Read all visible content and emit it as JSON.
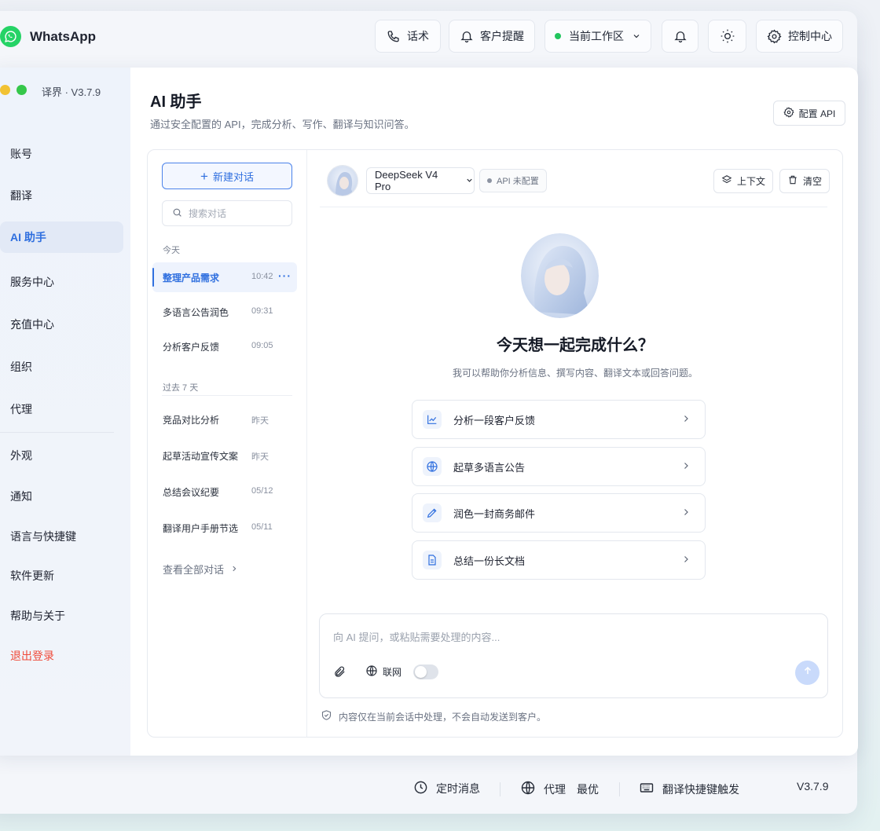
{
  "app": {
    "name": "WhatsApp",
    "version_label": "译界 · V3.7.9"
  },
  "topbar": {
    "scripts_label": "话术",
    "reminders_label": "客户提醒",
    "workspace_label": "当前工作区",
    "control_center_label": "控制中心"
  },
  "sidebar": {
    "items": [
      {
        "label": "账号"
      },
      {
        "label": "翻译"
      },
      {
        "label": "AI 助手"
      },
      {
        "label": "服务中心"
      },
      {
        "label": "充值中心"
      },
      {
        "label": "组织"
      },
      {
        "label": "代理"
      },
      {
        "label": "外观"
      },
      {
        "label": "通知"
      },
      {
        "label": "语言与快捷键"
      },
      {
        "label": "软件更新"
      },
      {
        "label": "帮助与关于"
      },
      {
        "label": "退出登录"
      }
    ]
  },
  "page": {
    "title": "AI 助手",
    "subtitle": "通过安全配置的 API，完成分析、写作、翻译与知识问答。",
    "config_api_label": "配置 API"
  },
  "conversations": {
    "new_chat_label": "新建对话",
    "search_placeholder": "搜索对话",
    "today_label": "今天",
    "past_label": "过去 7 天",
    "today": [
      {
        "title": "整理产品需求",
        "time": "10:42"
      },
      {
        "title": "多语言公告润色",
        "time": "09:31"
      },
      {
        "title": "分析客户反馈",
        "time": "09:05"
      }
    ],
    "past": [
      {
        "title": "竞品对比分析",
        "time": "昨天"
      },
      {
        "title": "起草活动宣传文案",
        "time": "昨天"
      },
      {
        "title": "总结会议纪要",
        "time": "05/12"
      },
      {
        "title": "翻译用户手册节选",
        "time": "05/11"
      }
    ],
    "see_all_label": "查看全部对话"
  },
  "chat": {
    "model": "DeepSeek V4 Pro",
    "api_status": "API 未配置",
    "context_label": "上下文",
    "clear_label": "清空",
    "welcome_title": "今天想一起完成什么？",
    "welcome_sub": "我可以帮助你分析信息、撰写内容、翻译文本或回答问题。",
    "suggestions": [
      {
        "label": "分析一段客户反馈",
        "icon": "chart-icon"
      },
      {
        "label": "起草多语言公告",
        "icon": "globe-icon"
      },
      {
        "label": "润色一封商务邮件",
        "icon": "pen-icon"
      },
      {
        "label": "总结一份长文档",
        "icon": "document-icon"
      }
    ],
    "input_placeholder": "向 AI 提问，或粘贴需要处理的内容...",
    "web_label": "联网",
    "web_enabled": false,
    "privacy_note": "内容仅在当前会话中处理，不会自动发送到客户。"
  },
  "bottombar": {
    "scheduled_label": "定时消息",
    "proxy_label": "代理",
    "proxy_value": "最优",
    "shortcut_label": "翻译快捷键触发",
    "version": "V3.7.9"
  },
  "colors": {
    "accent": "#2f6fdf",
    "whatsapp_green": "#25d366",
    "online_green": "#22c55e",
    "danger": "#ef4b3a"
  }
}
